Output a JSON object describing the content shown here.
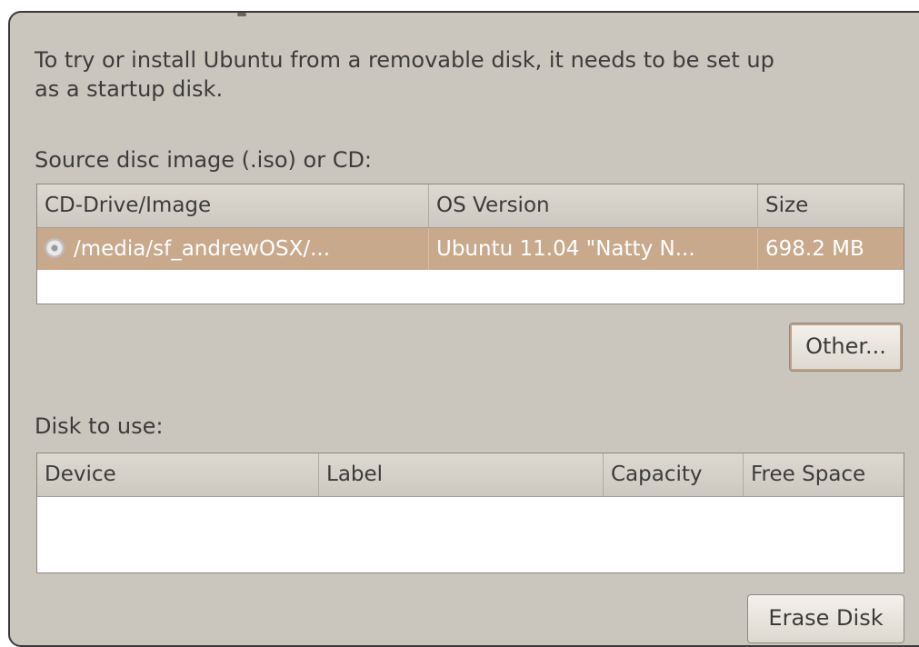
{
  "intro": {
    "line1": "To try or install Ubuntu from a removable disk, it needs to be set up",
    "line2": "as a startup disk."
  },
  "source": {
    "label": "Source disc image (.iso) or CD:",
    "columns": [
      "CD-Drive/Image",
      "OS Version",
      "Size"
    ],
    "rows": [
      {
        "icon": "disc-icon",
        "image": "/media/sf_andrewOSX/...",
        "os_version": "Ubuntu 11.04 \"Natty N...",
        "size": "698.2 MB"
      }
    ],
    "other_button": "Other..."
  },
  "disk": {
    "label": "Disk to use:",
    "columns": [
      "Device",
      "Label",
      "Capacity",
      "Free Space"
    ],
    "rows": [],
    "erase_button": "Erase Disk"
  },
  "colors": {
    "window_bg": "#cbc6bd",
    "selection": "#c8a98c",
    "text": "#3c3c3c"
  }
}
